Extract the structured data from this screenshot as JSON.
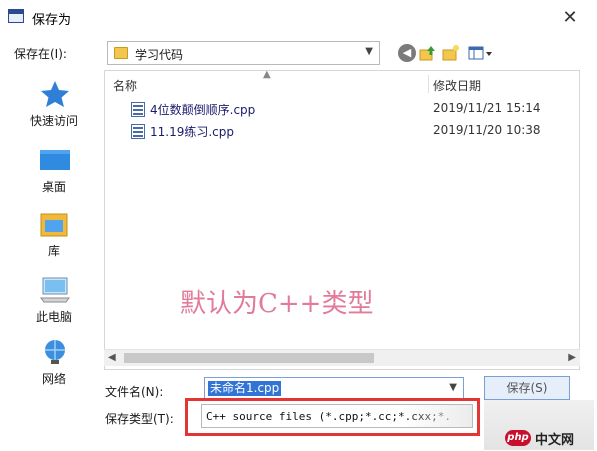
{
  "window": {
    "title": "保存为",
    "close_glyph": "✕"
  },
  "lookin": {
    "label": "保存在(I):",
    "value": "学习代码"
  },
  "places": [
    {
      "label": "快速访问",
      "icon": "star-icon"
    },
    {
      "label": "桌面",
      "icon": "desktop-icon"
    },
    {
      "label": "库",
      "icon": "library-icon"
    },
    {
      "label": "此电脑",
      "icon": "computer-icon"
    },
    {
      "label": "网络",
      "icon": "network-icon"
    }
  ],
  "filelist": {
    "columns": {
      "name": "名称",
      "date": "修改日期"
    },
    "files": [
      {
        "name": "4位数颠倒顺序.cpp",
        "date": "2019/11/21 15:14"
      },
      {
        "name": "11.19练习.cpp",
        "date": "2019/11/20 10:38"
      }
    ]
  },
  "annotation": "默认为C++类型",
  "filename": {
    "label": "文件名(N):",
    "value": "未命名1.cpp"
  },
  "filetype": {
    "label": "保存类型(T):",
    "value": "C++ source files (*.cpp;*.cc;*.cxx;*."
  },
  "buttons": {
    "save": "保存(S)"
  },
  "watermark": {
    "badge": "php",
    "text": "中文网"
  },
  "colors": {
    "highlight": "#e23535",
    "annotation": "#e27a9a",
    "selection": "#3174d6"
  }
}
